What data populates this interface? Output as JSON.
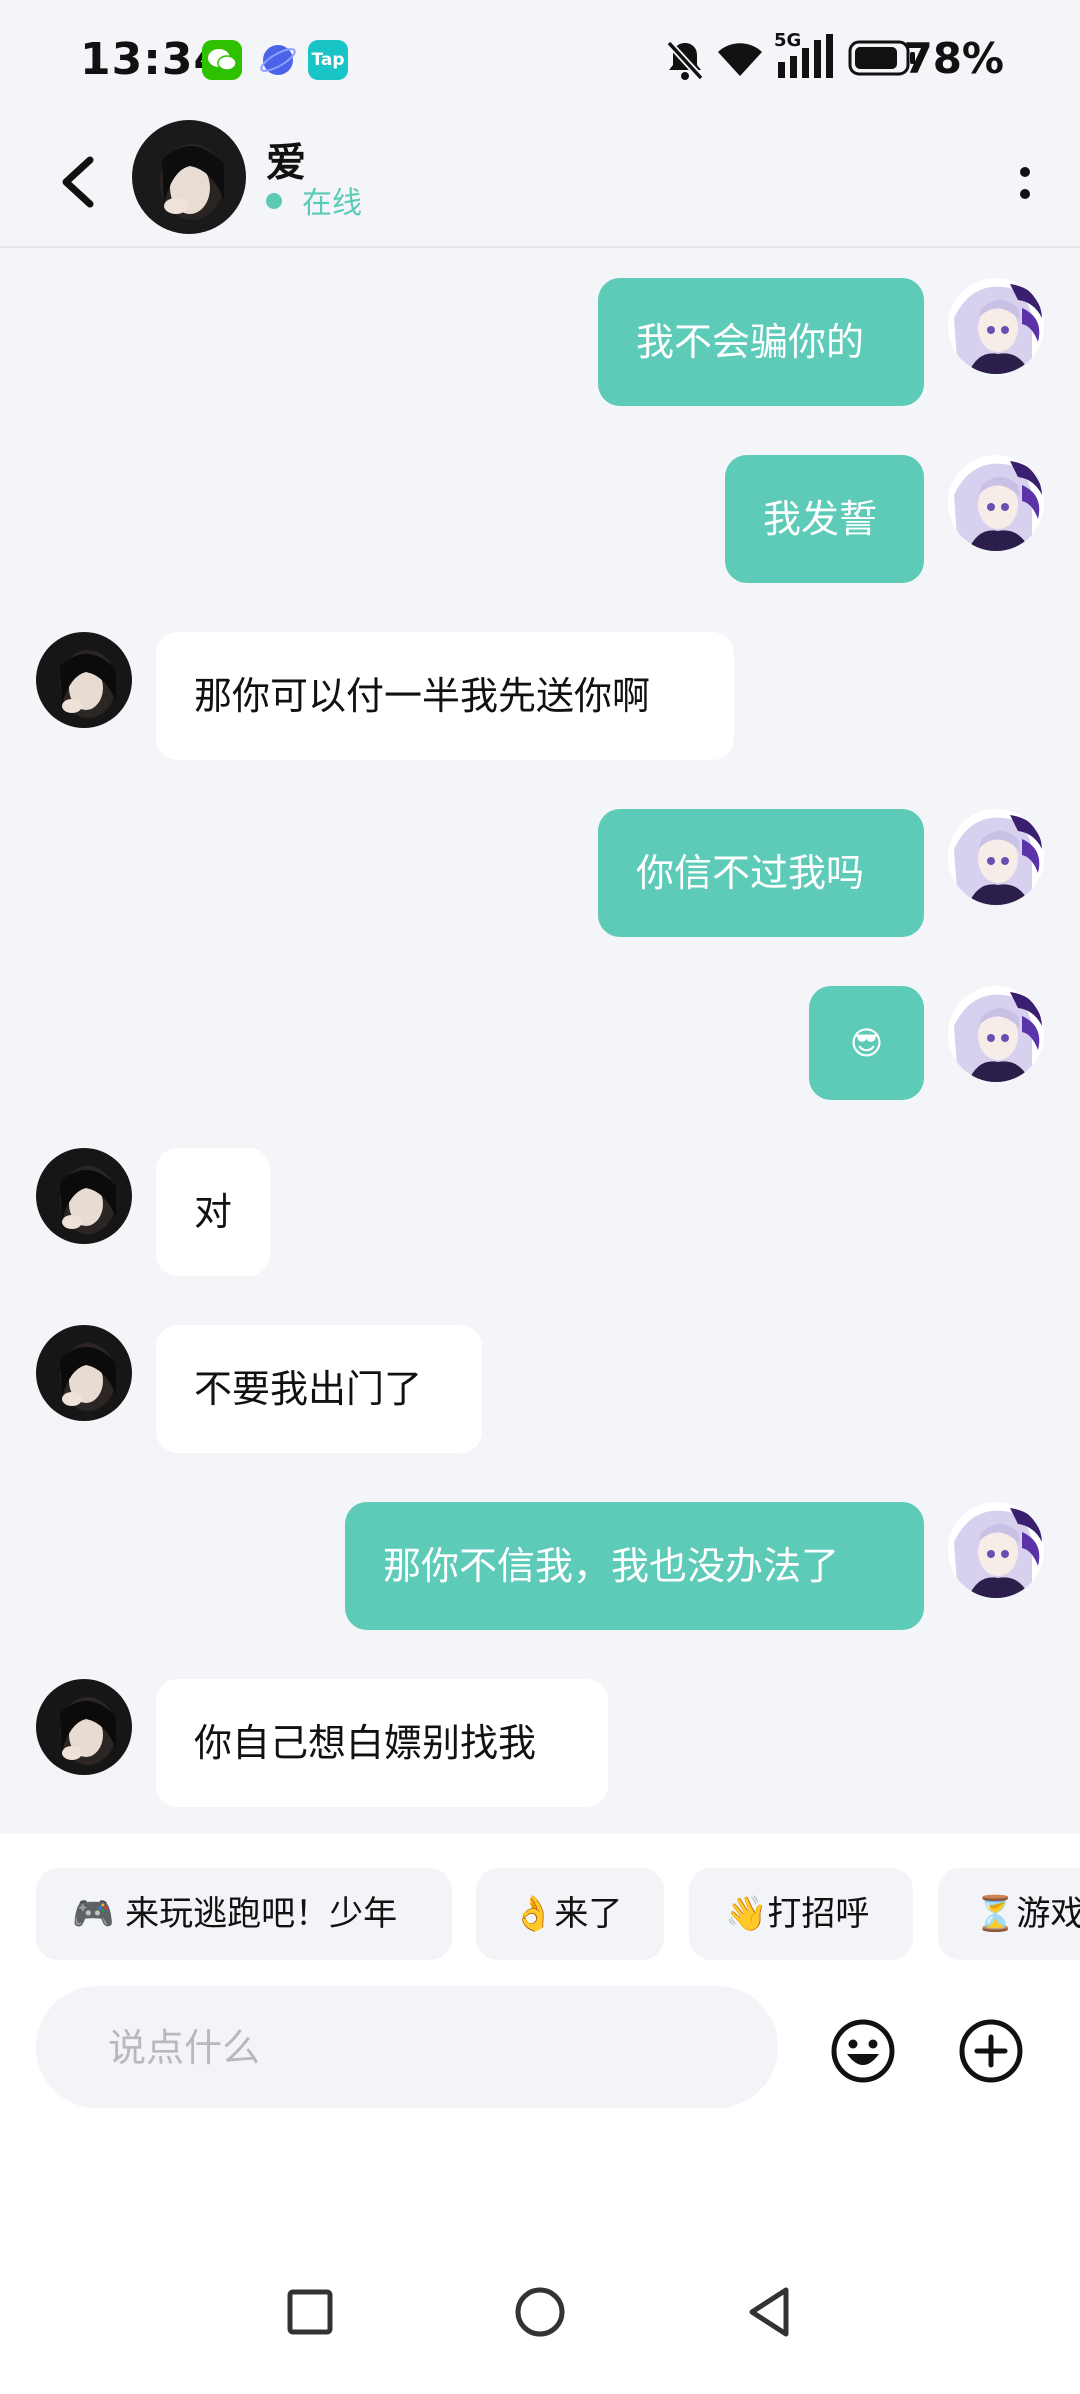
{
  "status_bar": {
    "time": "13:34",
    "battery_pct": "78%",
    "network": "5G",
    "apps": [
      {
        "icon": "wechat-icon",
        "color": "#2dc100"
      },
      {
        "icon": "browser-planet-icon",
        "color": "#4b63e8"
      },
      {
        "icon": "taptap-icon",
        "color": "#19c4c6",
        "label": "Tap"
      }
    ]
  },
  "header": {
    "contact_name": "爱",
    "status": "在线",
    "accent": "#5ccab5"
  },
  "messages": [
    {
      "side": "out",
      "text": "我不会骗你的"
    },
    {
      "side": "out",
      "text": "我发誓"
    },
    {
      "side": "in",
      "text": "那你可以付一半我先送你啊"
    },
    {
      "side": "out",
      "text": "你信不过我吗"
    },
    {
      "side": "out",
      "text": "😎"
    },
    {
      "side": "in",
      "text": "对"
    },
    {
      "side": "in",
      "text": "不要我出门了"
    },
    {
      "side": "out",
      "text": "那你不信我，我也没办法了"
    },
    {
      "side": "in",
      "text": "你自己想白嫖别找我"
    }
  ],
  "quick_replies": [
    {
      "text": "🎮 来玩逃跑吧！少年"
    },
    {
      "text": "👌来了"
    },
    {
      "text": "👋打招呼"
    },
    {
      "text": "⏳游戏"
    }
  ],
  "composer": {
    "placeholder": "说点什么"
  },
  "colors": {
    "outgoing_bubble": "#5ecbb8",
    "incoming_bubble": "#ffffff",
    "background": "#f4f5f9"
  }
}
